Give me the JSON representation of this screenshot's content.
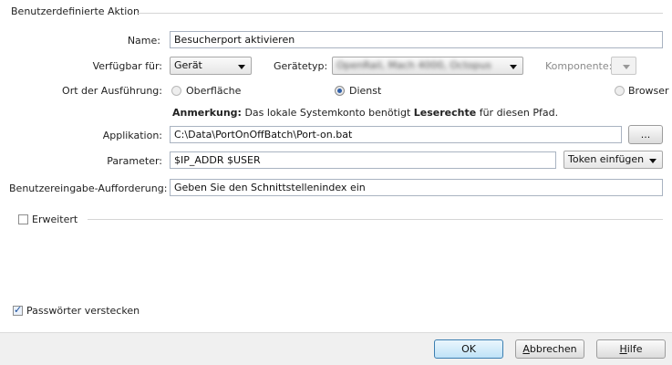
{
  "group": {
    "title": "Benutzerdefinierte Aktion"
  },
  "name": {
    "label": "Name:",
    "value": "Besucherport aktivieren"
  },
  "verfuegbar": {
    "label": "Verfügbar für:",
    "value": "Gerät"
  },
  "geraetetyp": {
    "label": "Gerätetyp:",
    "value": "OpenRail, Mach 4000, Octopus"
  },
  "komponente": {
    "label": "Komponente:",
    "value": ""
  },
  "ort": {
    "label": "Ort der Ausführung:",
    "options": [
      "Oberfläche",
      "Dienst",
      "Browser"
    ],
    "selected": "Dienst"
  },
  "anmerkung": {
    "bold_prefix": "Anmerkung:",
    "text_before": " Das lokale Systemkonto benötigt ",
    "bold_word": "Leserechte",
    "text_after": " für diesen Pfad."
  },
  "applikation": {
    "label": "Applikation:",
    "value": "C:\\Data\\PortOnOffBatch\\Port-on.bat",
    "browse_label": "..."
  },
  "parameter": {
    "label": "Parameter:",
    "value": "$IP_ADDR $USER",
    "token_label": "Token einfügen"
  },
  "aufforderung": {
    "label": "Benutzereingabe-Aufforderung:",
    "value": "Geben Sie den Schnittstellenindex ein"
  },
  "erweitert": {
    "label": "Erweitert",
    "checked": false
  },
  "passwoerter": {
    "label": "Passwörter verstecken",
    "checked": true
  },
  "buttons": {
    "ok": "OK",
    "abbrechen_first": "A",
    "abbrechen_rest": "bbrechen",
    "hilfe_first": "H",
    "hilfe_rest": "ilfe"
  },
  "colors": {
    "accent": "#2f5fa8",
    "default_button": "#bfe2f7"
  }
}
